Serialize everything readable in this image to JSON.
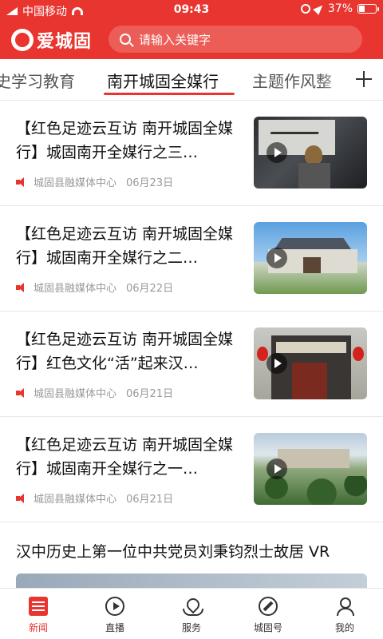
{
  "status_bar": {
    "carrier": "中国移动",
    "time": "09:43",
    "battery": "37%",
    "battery_level": 0.37
  },
  "header": {
    "app_name": "爱城固",
    "search_placeholder": "请输入关键字"
  },
  "tabs": [
    {
      "label": "史学习教育"
    },
    {
      "label": "南开城固全媒行"
    },
    {
      "label": "主题作风整"
    }
  ],
  "active_tab": "南开城固全媒行",
  "news": [
    {
      "title": "【红色足迹云互访  南开城固全媒行】城固南开全媒行之三…",
      "source": "城固县融媒体中心",
      "date": "06月23日"
    },
    {
      "title": "【红色足迹云互访  南开城固全媒行】城固南开全媒行之二…",
      "source": "城固县融媒体中心",
      "date": "06月22日"
    },
    {
      "title": "【红色足迹云互访  南开城固全媒行】红色文化“活”起来汉…",
      "source": "城固县融媒体中心",
      "date": "06月21日"
    },
    {
      "title": "【红色足迹云互访 南开城固全媒行】城固南开全媒行之一…",
      "source": "城固县融媒体中心",
      "date": "06月21日"
    }
  ],
  "wide_news": {
    "title": "汉中历史上第一位中共党员刘秉钧烈士故居 VR"
  },
  "bottom_nav": [
    {
      "label": "新闻",
      "icon": "news-icon"
    },
    {
      "label": "直播",
      "icon": "play-circle-icon"
    },
    {
      "label": "服务",
      "icon": "service-icon"
    },
    {
      "label": "城固号",
      "icon": "compass-icon"
    },
    {
      "label": "我的",
      "icon": "user-icon"
    }
  ],
  "colors": {
    "brand": "#e8352f"
  }
}
